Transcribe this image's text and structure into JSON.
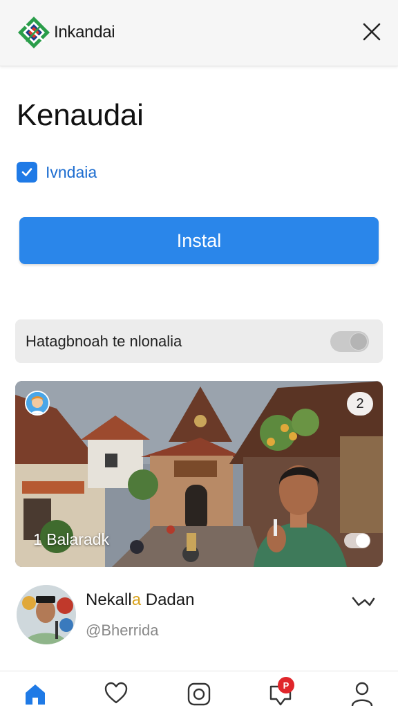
{
  "header": {
    "app_name": "Inkandai",
    "logo_icon": "diamond-logo-icon",
    "close_icon": "close-icon"
  },
  "main": {
    "title": "Kenaudai",
    "checkbox": {
      "label": "Ivndaia",
      "checked": true
    },
    "install_button": "Instal",
    "setting": {
      "label": "Hatagbnoah te nlonalia",
      "toggle_on": false
    }
  },
  "media": {
    "caption": "Balaradk",
    "caption_icon": "1",
    "badge_icon": "2",
    "toggle_on": true
  },
  "profile": {
    "name_part1": "Nekall",
    "name_highlight": "a",
    "name_part2": " Dadan",
    "handle": "@Bherrida",
    "more_icon": "chevron-wave-icon"
  },
  "nav": {
    "items": [
      "home-icon",
      "heart-icon",
      "instagram-icon",
      "notification-icon",
      "profile-icon"
    ],
    "notification_badge": "P"
  },
  "colors": {
    "accent": "#2a86ea",
    "check": "#1f7ae6",
    "badge": "#e0262b"
  }
}
